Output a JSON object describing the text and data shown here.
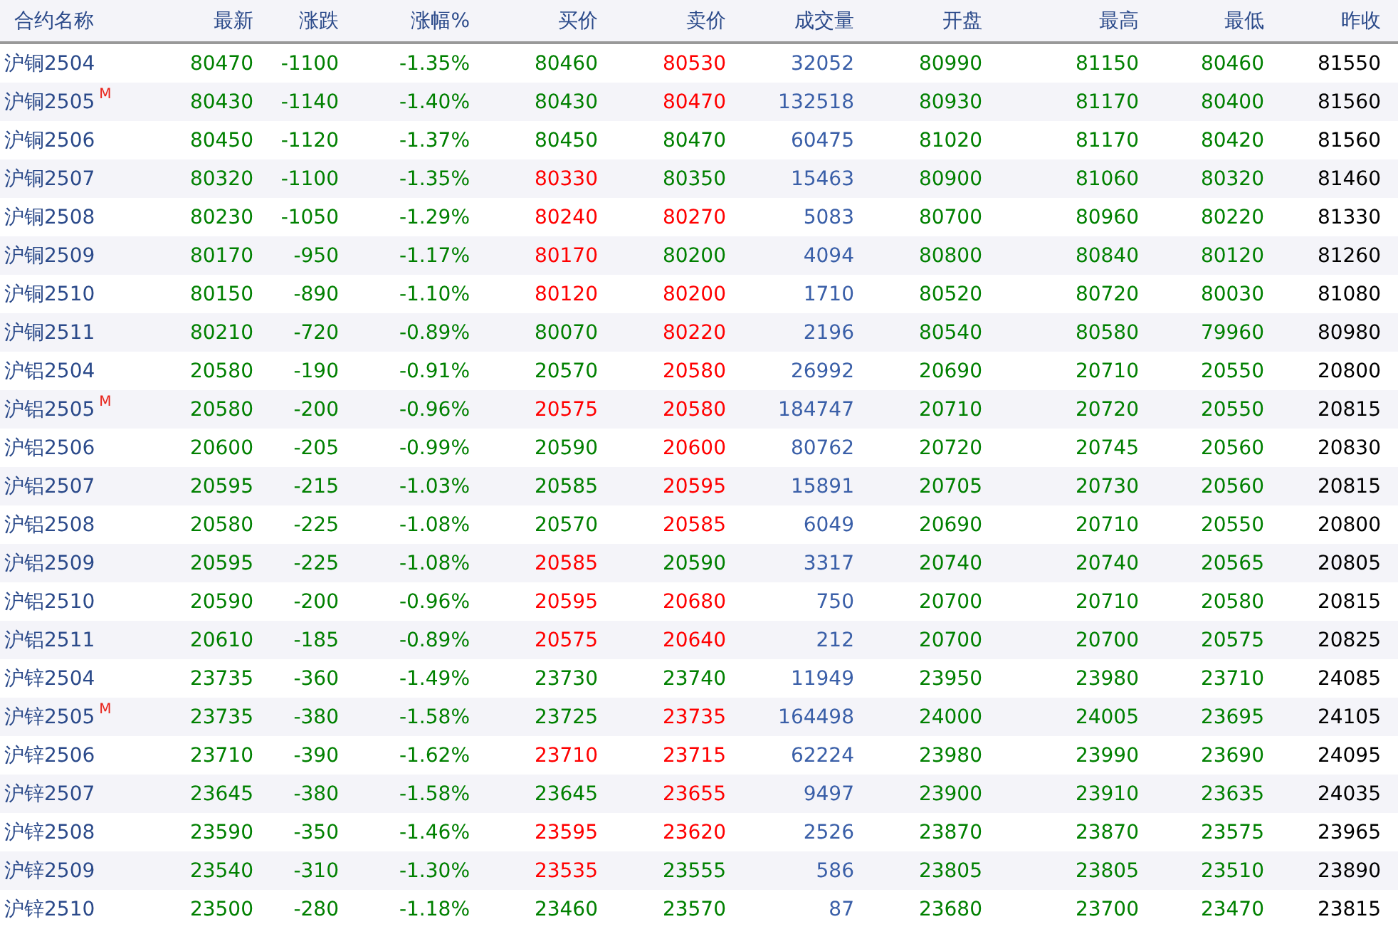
{
  "columns": [
    "合约名称",
    "最新",
    "涨跌",
    "涨幅%",
    "买价",
    "卖价",
    "成交量",
    "开盘",
    "最高",
    "最低",
    "昨收"
  ],
  "rows": [
    {
      "name": "沪铜2504",
      "latest": "80470",
      "change": "-1100",
      "pct": "-1.35%",
      "bid": "80460",
      "bid_up": false,
      "ask": "80530",
      "ask_up": true,
      "volume": "32052",
      "open": "80990",
      "high": "81150",
      "low": "80460",
      "prev": "81550"
    },
    {
      "name": "沪铜2505",
      "badge": "M",
      "latest": "80430",
      "change": "-1140",
      "pct": "-1.40%",
      "bid": "80430",
      "bid_up": false,
      "ask": "80470",
      "ask_up": true,
      "volume": "132518",
      "open": "80930",
      "high": "81170",
      "low": "80400",
      "prev": "81560"
    },
    {
      "name": "沪铜2506",
      "latest": "80450",
      "change": "-1120",
      "pct": "-1.37%",
      "bid": "80450",
      "bid_up": false,
      "ask": "80470",
      "ask_up": false,
      "volume": "60475",
      "open": "81020",
      "high": "81170",
      "low": "80420",
      "prev": "81560"
    },
    {
      "name": "沪铜2507",
      "latest": "80320",
      "change": "-1100",
      "pct": "-1.35%",
      "bid": "80330",
      "bid_up": true,
      "ask": "80350",
      "ask_up": false,
      "volume": "15463",
      "open": "80900",
      "high": "81060",
      "low": "80320",
      "prev": "81460"
    },
    {
      "name": "沪铜2508",
      "latest": "80230",
      "change": "-1050",
      "pct": "-1.29%",
      "bid": "80240",
      "bid_up": true,
      "ask": "80270",
      "ask_up": true,
      "volume": "5083",
      "open": "80700",
      "high": "80960",
      "low": "80220",
      "prev": "81330"
    },
    {
      "name": "沪铜2509",
      "latest": "80170",
      "change": "-950",
      "pct": "-1.17%",
      "bid": "80170",
      "bid_up": true,
      "ask": "80200",
      "ask_up": false,
      "volume": "4094",
      "open": "80800",
      "high": "80840",
      "low": "80120",
      "prev": "81260"
    },
    {
      "name": "沪铜2510",
      "latest": "80150",
      "change": "-890",
      "pct": "-1.10%",
      "bid": "80120",
      "bid_up": true,
      "ask": "80200",
      "ask_up": true,
      "volume": "1710",
      "open": "80520",
      "high": "80720",
      "low": "80030",
      "prev": "81080"
    },
    {
      "name": "沪铜2511",
      "latest": "80210",
      "change": "-720",
      "pct": "-0.89%",
      "bid": "80070",
      "bid_up": false,
      "ask": "80220",
      "ask_up": true,
      "volume": "2196",
      "open": "80540",
      "high": "80580",
      "low": "79960",
      "prev": "80980"
    },
    {
      "name": "沪铝2504",
      "latest": "20580",
      "change": "-190",
      "pct": "-0.91%",
      "bid": "20570",
      "bid_up": false,
      "ask": "20580",
      "ask_up": true,
      "volume": "26992",
      "open": "20690",
      "high": "20710",
      "low": "20550",
      "prev": "20800"
    },
    {
      "name": "沪铝2505",
      "badge": "M",
      "latest": "20580",
      "change": "-200",
      "pct": "-0.96%",
      "bid": "20575",
      "bid_up": true,
      "ask": "20580",
      "ask_up": true,
      "volume": "184747",
      "open": "20710",
      "high": "20720",
      "low": "20550",
      "prev": "20815"
    },
    {
      "name": "沪铝2506",
      "latest": "20600",
      "change": "-205",
      "pct": "-0.99%",
      "bid": "20590",
      "bid_up": false,
      "ask": "20600",
      "ask_up": true,
      "volume": "80762",
      "open": "20720",
      "high": "20745",
      "low": "20560",
      "prev": "20830"
    },
    {
      "name": "沪铝2507",
      "latest": "20595",
      "change": "-215",
      "pct": "-1.03%",
      "bid": "20585",
      "bid_up": false,
      "ask": "20595",
      "ask_up": true,
      "volume": "15891",
      "open": "20705",
      "high": "20730",
      "low": "20560",
      "prev": "20815"
    },
    {
      "name": "沪铝2508",
      "latest": "20580",
      "change": "-225",
      "pct": "-1.08%",
      "bid": "20570",
      "bid_up": false,
      "ask": "20585",
      "ask_up": true,
      "volume": "6049",
      "open": "20690",
      "high": "20710",
      "low": "20550",
      "prev": "20800"
    },
    {
      "name": "沪铝2509",
      "latest": "20595",
      "change": "-225",
      "pct": "-1.08%",
      "bid": "20585",
      "bid_up": true,
      "ask": "20590",
      "ask_up": false,
      "volume": "3317",
      "open": "20740",
      "high": "20740",
      "low": "20565",
      "prev": "20805"
    },
    {
      "name": "沪铝2510",
      "latest": "20590",
      "change": "-200",
      "pct": "-0.96%",
      "bid": "20595",
      "bid_up": true,
      "ask": "20680",
      "ask_up": true,
      "volume": "750",
      "open": "20700",
      "high": "20710",
      "low": "20580",
      "prev": "20815"
    },
    {
      "name": "沪铝2511",
      "latest": "20610",
      "change": "-185",
      "pct": "-0.89%",
      "bid": "20575",
      "bid_up": true,
      "ask": "20640",
      "ask_up": true,
      "volume": "212",
      "open": "20700",
      "high": "20700",
      "low": "20575",
      "prev": "20825"
    },
    {
      "name": "沪锌2504",
      "latest": "23735",
      "change": "-360",
      "pct": "-1.49%",
      "bid": "23730",
      "bid_up": false,
      "ask": "23740",
      "ask_up": false,
      "volume": "11949",
      "open": "23950",
      "high": "23980",
      "low": "23710",
      "prev": "24085"
    },
    {
      "name": "沪锌2505",
      "badge": "M",
      "latest": "23735",
      "change": "-380",
      "pct": "-1.58%",
      "bid": "23725",
      "bid_up": false,
      "ask": "23735",
      "ask_up": true,
      "volume": "164498",
      "open": "24000",
      "high": "24005",
      "low": "23695",
      "prev": "24105"
    },
    {
      "name": "沪锌2506",
      "latest": "23710",
      "change": "-390",
      "pct": "-1.62%",
      "bid": "23710",
      "bid_up": true,
      "ask": "23715",
      "ask_up": true,
      "volume": "62224",
      "open": "23980",
      "high": "23990",
      "low": "23690",
      "prev": "24095"
    },
    {
      "name": "沪锌2507",
      "latest": "23645",
      "change": "-380",
      "pct": "-1.58%",
      "bid": "23645",
      "bid_up": false,
      "ask": "23655",
      "ask_up": true,
      "volume": "9497",
      "open": "23900",
      "high": "23910",
      "low": "23635",
      "prev": "24035"
    },
    {
      "name": "沪锌2508",
      "latest": "23590",
      "change": "-350",
      "pct": "-1.46%",
      "bid": "23595",
      "bid_up": true,
      "ask": "23620",
      "ask_up": true,
      "volume": "2526",
      "open": "23870",
      "high": "23870",
      "low": "23575",
      "prev": "23965"
    },
    {
      "name": "沪锌2509",
      "latest": "23540",
      "change": "-310",
      "pct": "-1.30%",
      "bid": "23535",
      "bid_up": true,
      "ask": "23555",
      "ask_up": false,
      "volume": "586",
      "open": "23805",
      "high": "23805",
      "low": "23510",
      "prev": "23890"
    },
    {
      "name": "沪锌2510",
      "latest": "23500",
      "change": "-280",
      "pct": "-1.18%",
      "bid": "23460",
      "bid_up": false,
      "ask": "23570",
      "ask_up": false,
      "volume": "87",
      "open": "23680",
      "high": "23700",
      "low": "23470",
      "prev": "23815"
    }
  ]
}
